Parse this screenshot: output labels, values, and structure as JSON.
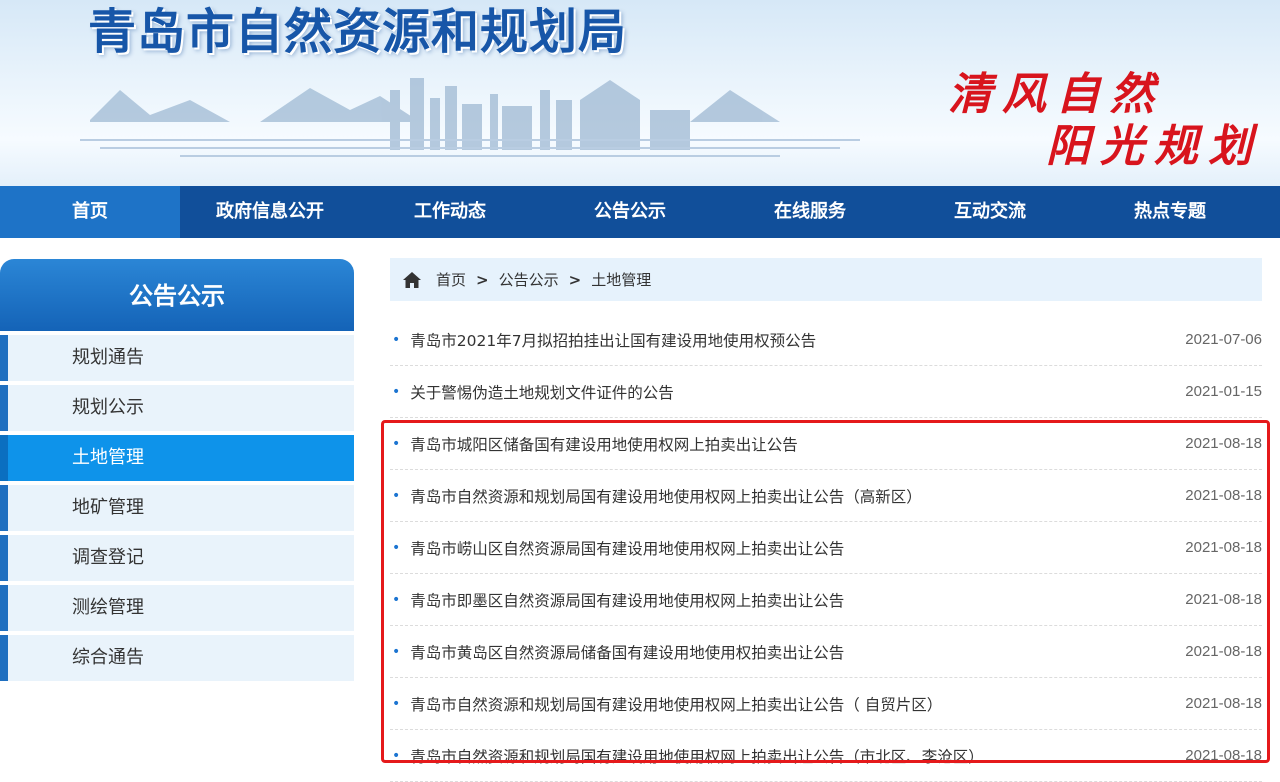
{
  "header": {
    "site_title": "青岛市自然资源和规划局",
    "slogan_line1": "清风自然",
    "slogan_line2": "阳光规划"
  },
  "nav": {
    "items": [
      {
        "label": "首页"
      },
      {
        "label": "政府信息公开"
      },
      {
        "label": "工作动态"
      },
      {
        "label": "公告公示"
      },
      {
        "label": "在线服务"
      },
      {
        "label": "互动交流"
      },
      {
        "label": "热点专题"
      }
    ],
    "active_index": 0
  },
  "sidebar": {
    "title": "公告公示",
    "items": [
      {
        "label": "规划通告"
      },
      {
        "label": "规划公示"
      },
      {
        "label": "土地管理"
      },
      {
        "label": "地矿管理"
      },
      {
        "label": "调查登记"
      },
      {
        "label": "测绘管理"
      },
      {
        "label": "综合通告"
      }
    ],
    "active_label": "土地管理"
  },
  "breadcrumb": {
    "home": "首页",
    "sep": ">",
    "level1": "公告公示",
    "level2": "土地管理"
  },
  "list": {
    "bullet": "•",
    "items": [
      {
        "title": "青岛市2021年7月拟招拍挂出让国有建设用地使用权预公告",
        "date": "2021-07-06"
      },
      {
        "title": "关于警惕伪造土地规划文件证件的公告",
        "date": "2021-01-15"
      },
      {
        "title": "青岛市城阳区储备国有建设用地使用权网上拍卖出让公告",
        "date": "2021-08-18"
      },
      {
        "title": "青岛市自然资源和规划局国有建设用地使用权网上拍卖出让公告（高新区）",
        "date": "2021-08-18"
      },
      {
        "title": "青岛市崂山区自然资源局国有建设用地使用权网上拍卖出让公告",
        "date": "2021-08-18"
      },
      {
        "title": "青岛市即墨区自然资源局国有建设用地使用权网上拍卖出让公告",
        "date": "2021-08-18"
      },
      {
        "title": "青岛市黄岛区自然资源局储备国有建设用地使用权拍卖出让公告",
        "date": "2021-08-18"
      },
      {
        "title": "青岛市自然资源和规划局国有建设用地使用权网上拍卖出让公告（ 自贸片区）",
        "date": "2021-08-18"
      },
      {
        "title": "青岛市自然资源和规划局国有建设用地使用权网上拍卖出让公告（市北区、李沧区）",
        "date": "2021-08-18"
      }
    ]
  },
  "colors": {
    "nav_bg": "#114f9a",
    "nav_active": "#1e73c7",
    "sidebar_active": "#0e93ea",
    "highlight": "#e5191b",
    "slogan": "#d8141d"
  }
}
